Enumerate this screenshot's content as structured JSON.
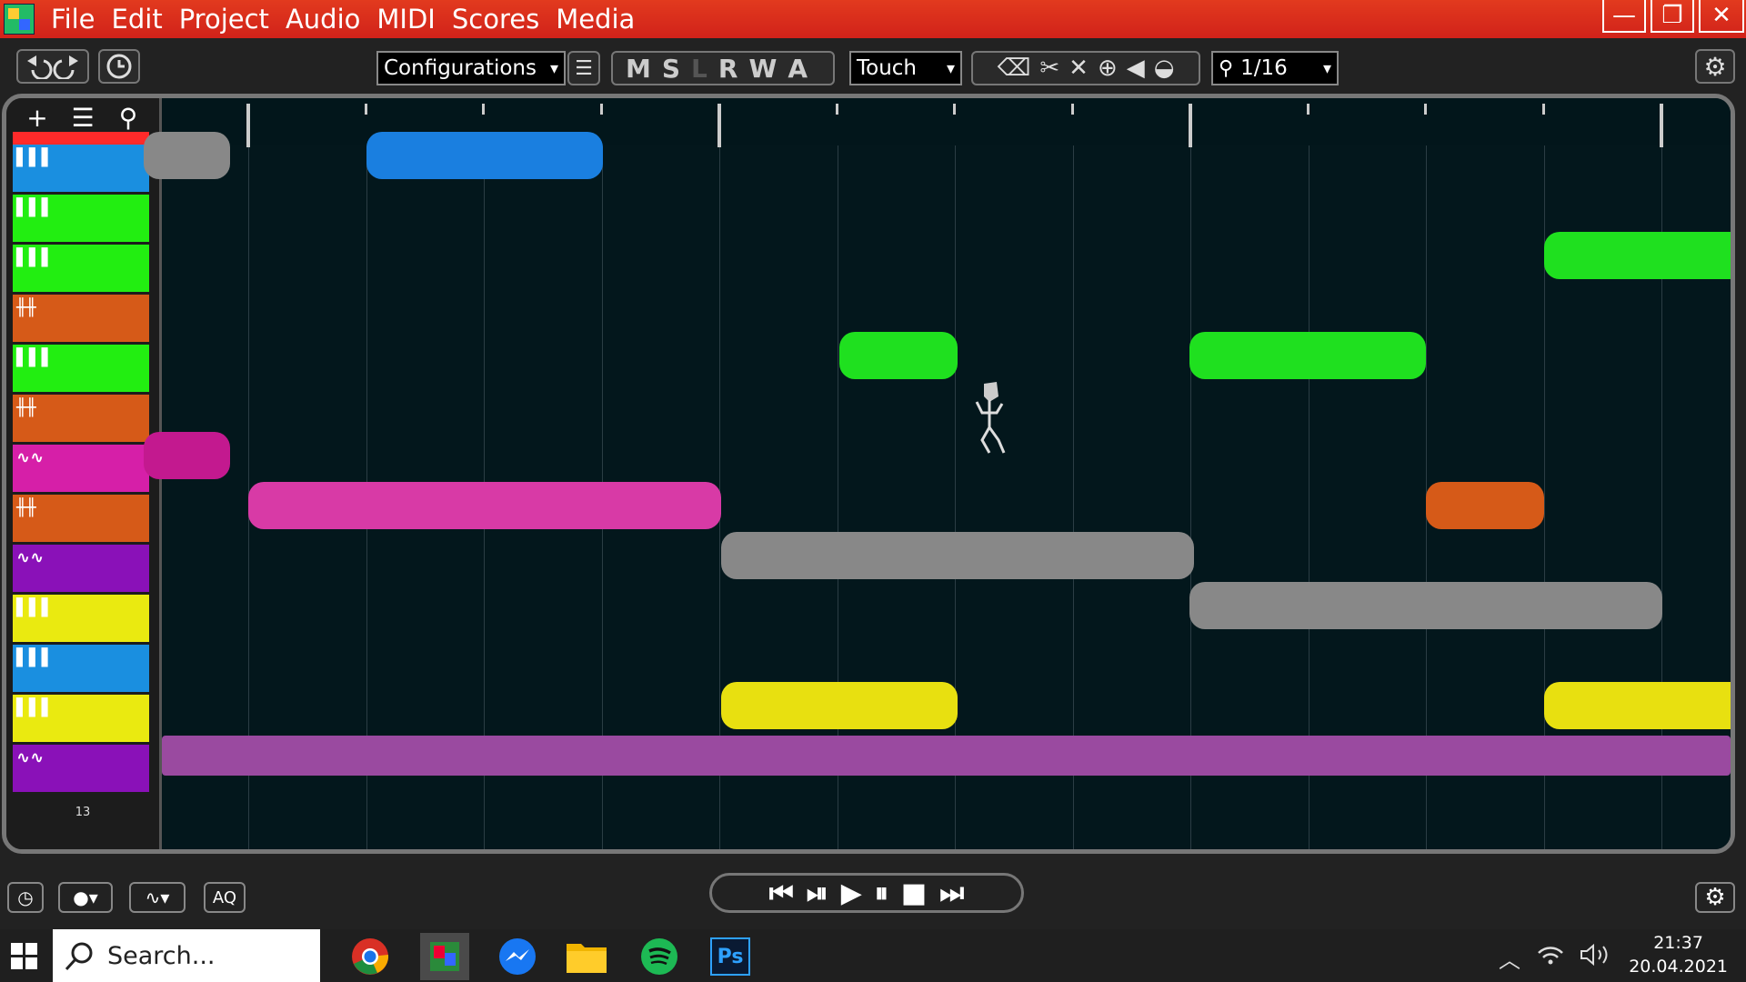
{
  "window": {
    "menu": [
      "File",
      "Edit",
      "Project",
      "Audio",
      "MIDI",
      "Scores",
      "Media"
    ],
    "controls": {
      "minimize": "—",
      "maximize": "❐",
      "close": "✕"
    }
  },
  "toolbar": {
    "undo_icon": "undo-icon",
    "redo_icon": "redo-icon",
    "configurations": "Configurations",
    "mode_letters": [
      "M",
      "S",
      "L",
      "R",
      "W",
      "A"
    ],
    "automation_mode": "Touch",
    "tools": [
      "eraser-icon",
      "scissors-icon",
      "delete-icon",
      "zoom-icon",
      "speaker-icon",
      "glue-icon"
    ],
    "quantize": "1/16",
    "dropdown_arrow": "▾"
  },
  "track_panel": {
    "add": "+",
    "list": "☰",
    "search": "⚲",
    "track_count": "13",
    "tracks": [
      {
        "type": "folder",
        "color": "#ff2a2a"
      },
      {
        "type": "midi",
        "color": "#1a8fe0"
      },
      {
        "type": "midi",
        "color": "#22ee11"
      },
      {
        "type": "midi",
        "color": "#22ee11"
      },
      {
        "type": "audio",
        "color": "#d65a18"
      },
      {
        "type": "midi",
        "color": "#22ee11"
      },
      {
        "type": "audio",
        "color": "#d65a18"
      },
      {
        "type": "wave",
        "color": "#d61fa8"
      },
      {
        "type": "audio",
        "color": "#d65a18"
      },
      {
        "type": "wave",
        "color": "#8a11b8"
      },
      {
        "type": "midi",
        "color": "#eaea10"
      },
      {
        "type": "midi",
        "color": "#1a8fe0"
      },
      {
        "type": "midi",
        "color": "#eaea10"
      },
      {
        "type": "wave",
        "color": "#8a11b8"
      }
    ]
  },
  "clips": [
    {
      "row": 1,
      "color": "#888888"
    },
    {
      "row": 1,
      "color": "#1a7fe0"
    },
    {
      "row": 3,
      "color": "#1fe01f"
    },
    {
      "row": 5,
      "color": "#1fe01f"
    },
    {
      "row": 5,
      "color": "#1fe01f"
    },
    {
      "row": 7,
      "color": "#c3198f"
    },
    {
      "row": 8,
      "color": "#d83aa6"
    },
    {
      "row": 8,
      "color": "#d65a18"
    },
    {
      "row": 9,
      "color": "#888888"
    },
    {
      "row": 10,
      "color": "#888888"
    },
    {
      "row": 12,
      "color": "#e8e010"
    },
    {
      "row": 12,
      "color": "#e8e010"
    },
    {
      "row": 13,
      "color": "#9a4aa0"
    }
  ],
  "transport": [
    "⏮",
    "⏯",
    "▶",
    "⏸",
    "■",
    "⏭"
  ],
  "bottom": {
    "record_mode": "●▾",
    "wave_mode": "∿▾",
    "aq": "AQ"
  },
  "taskbar": {
    "search_placeholder": "Search...",
    "apps": [
      "chrome-icon",
      "lmms-icon",
      "messenger-icon",
      "explorer-icon",
      "spotify-icon",
      "photoshop-icon"
    ],
    "photoshop_label": "Ps",
    "time": "21:37",
    "date": "20.04.2021"
  }
}
